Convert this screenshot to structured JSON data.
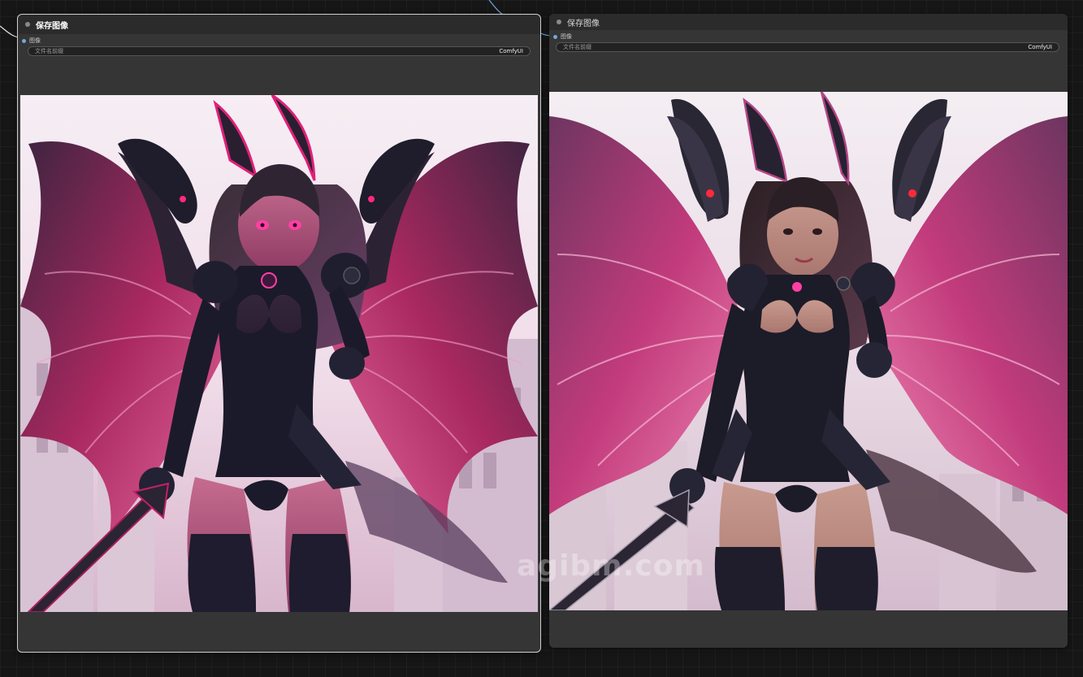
{
  "nodes": [
    {
      "title": "保存图像",
      "input_label": "图像",
      "widget_label": "文件名前缀",
      "widget_value": "ComfyUI"
    },
    {
      "title": "保存图像",
      "input_label": "图像",
      "widget_label": "文件名前缀",
      "widget_value": "ComfyUI"
    }
  ],
  "watermark": "agibm.com",
  "colors": {
    "canvas": "#161616",
    "node_body": "#353535",
    "node_header": "#2b2b2b",
    "link": "#6fa8dc",
    "selected_outline": "#cfcfcf"
  }
}
